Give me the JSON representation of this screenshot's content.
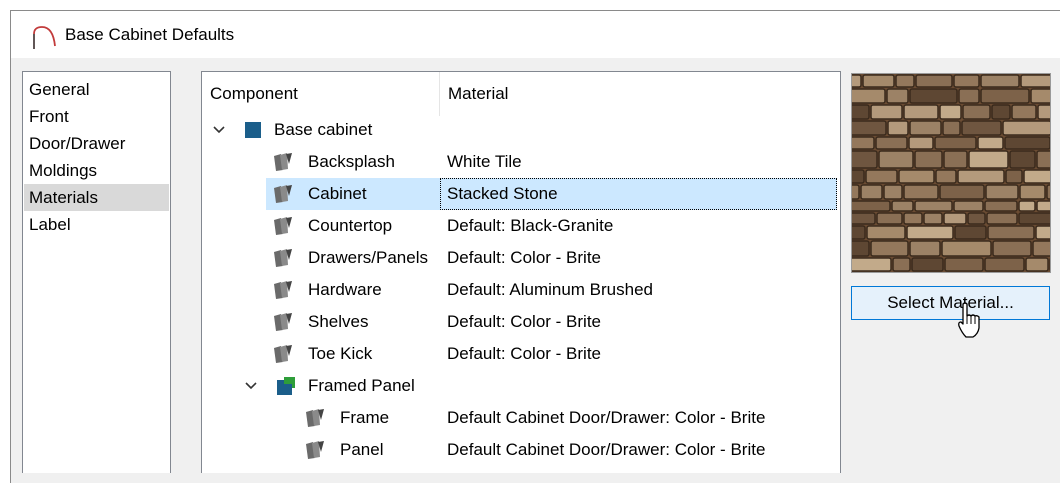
{
  "window": {
    "title": "Base Cabinet Defaults"
  },
  "nav": {
    "items": [
      {
        "label": "General",
        "selected": false
      },
      {
        "label": "Front",
        "selected": false
      },
      {
        "label": "Door/Drawer",
        "selected": false
      },
      {
        "label": "Moldings",
        "selected": false
      },
      {
        "label": "Materials",
        "selected": true
      },
      {
        "label": "Label",
        "selected": false
      }
    ]
  },
  "table": {
    "columns": [
      "Component",
      "Material"
    ],
    "rows": [
      {
        "component": "Base cabinet",
        "material": "",
        "icon": "cabinet-group-icon",
        "expanded": true,
        "level": 0
      },
      {
        "component": "Backsplash",
        "material": "White Tile",
        "icon": "material-swatch-icon",
        "level": 1
      },
      {
        "component": "Cabinet",
        "material": "Stacked Stone",
        "icon": "material-swatch-icon",
        "level": 1,
        "selected": true
      },
      {
        "component": "Countertop",
        "material": "Default: Black-Granite",
        "icon": "material-swatch-icon",
        "level": 1
      },
      {
        "component": "Drawers/Panels",
        "material": "Default: Color - Brite",
        "icon": "material-swatch-icon",
        "level": 1
      },
      {
        "component": "Hardware",
        "material": "Default: Aluminum Brushed",
        "icon": "material-swatch-icon",
        "level": 1
      },
      {
        "component": "Shelves",
        "material": "Default: Color - Brite",
        "icon": "material-swatch-icon",
        "level": 1
      },
      {
        "component": "Toe Kick",
        "material": "Default: Color - Brite",
        "icon": "material-swatch-icon",
        "level": 1
      },
      {
        "component": "Framed Panel",
        "material": "",
        "icon": "framed-panel-icon",
        "expanded": true,
        "level": 1
      },
      {
        "component": "Frame",
        "material": "Default Cabinet Door/Drawer: Color - Brite",
        "icon": "material-swatch-icon",
        "level": 2
      },
      {
        "component": "Panel",
        "material": "Default Cabinet Door/Drawer: Color - Brite",
        "icon": "material-swatch-icon",
        "level": 2
      }
    ]
  },
  "preview": {
    "material_name": "Stacked Stone",
    "icon": "stone-texture-preview"
  },
  "buttons": {
    "select_material": "Select Material..."
  },
  "colors": {
    "selection": "#cce8ff",
    "nav_selected": "#d9d9d9",
    "button_focus_border": "#0078d7",
    "icon_blue": "#1b5e8a",
    "icon_green": "#2e9e3a"
  }
}
